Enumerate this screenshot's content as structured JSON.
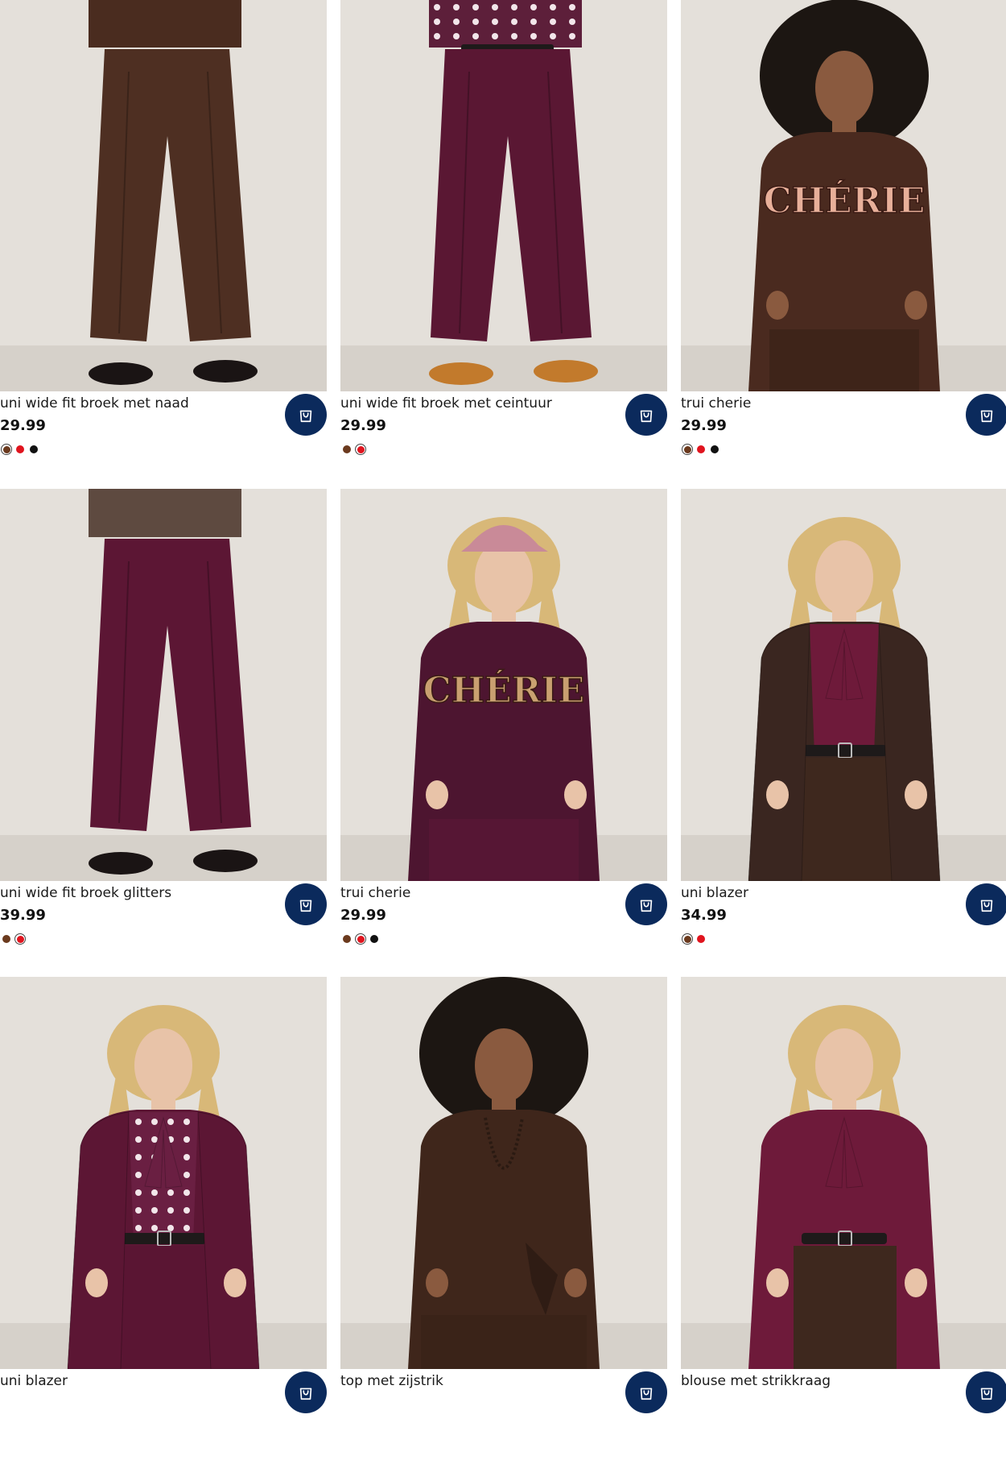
{
  "colors": {
    "cart_button": "#0b2a5c",
    "brown": "#6b3a1e",
    "red": "#e0141e",
    "black": "#111111",
    "photo_background": "#e4e0da"
  },
  "cart_icon": "shopping-bag-icon",
  "products": [
    {
      "name": "uni wide fit broek met naad",
      "price": "29.99",
      "swatches": [
        {
          "color": "#6b3a1e",
          "selected": true
        },
        {
          "color": "#e0141e",
          "selected": false
        },
        {
          "color": "#111111",
          "selected": false
        }
      ],
      "garment_top": "#4a2c1f",
      "garment_bottom": "#4e2f22",
      "hair": "#4a3424",
      "style": "pants"
    },
    {
      "name": "uni wide fit broek met ceintuur",
      "price": "29.99",
      "swatches": [
        {
          "color": "#6b3a1e",
          "selected": false
        },
        {
          "color": "#e0141e",
          "selected": true
        }
      ],
      "garment_top": "#5d1f3a",
      "garment_bottom": "#5a1733",
      "hair": "#4a3424",
      "style": "pants-dots"
    },
    {
      "name": "trui cherie",
      "price": "29.99",
      "swatches": [
        {
          "color": "#6b3a1e",
          "selected": true
        },
        {
          "color": "#e0141e",
          "selected": false
        },
        {
          "color": "#111111",
          "selected": false
        }
      ],
      "garment_top": "#4a2a1f",
      "garment_bottom": "#3e2419",
      "hair": "#1c1612",
      "style": "sweater"
    },
    {
      "name": "uni wide fit broek glitters",
      "price": "39.99",
      "swatches": [
        {
          "color": "#6b3a1e",
          "selected": false
        },
        {
          "color": "#e0141e",
          "selected": true
        }
      ],
      "garment_top": "#5e4a40",
      "garment_bottom": "#5c1634",
      "hair": "#4a3424",
      "style": "pants"
    },
    {
      "name": "trui cherie",
      "price": "29.99",
      "swatches": [
        {
          "color": "#6b3a1e",
          "selected": false
        },
        {
          "color": "#e0141e",
          "selected": true
        },
        {
          "color": "#111111",
          "selected": false
        }
      ],
      "garment_top": "#4d1530",
      "garment_bottom": "#561634",
      "hair": "#d8b878",
      "style": "sweater-cap"
    },
    {
      "name": "uni blazer",
      "price": "34.99",
      "swatches": [
        {
          "color": "#6b3a1e",
          "selected": true
        },
        {
          "color": "#e0141e",
          "selected": false
        }
      ],
      "garment_top": "#3a2620",
      "garment_bottom": "#3e281e",
      "hair": "#d8b878",
      "style": "blazer"
    },
    {
      "name": "uni blazer",
      "price": "",
      "swatches": [],
      "garment_top": "#5c1634",
      "garment_bottom": "#5a1533",
      "hair": "#d8b878",
      "style": "blazer-dots"
    },
    {
      "name": "top met zijstrik",
      "price": "",
      "swatches": [],
      "garment_top": "#3f261b",
      "garment_bottom": "#3a2318",
      "hair": "#1c1612",
      "style": "top"
    },
    {
      "name": "blouse met strikkraag",
      "price": "",
      "swatches": [],
      "garment_top": "#6e1a3a",
      "garment_bottom": "#3e281e",
      "hair": "#d8b878",
      "style": "blouse"
    }
  ]
}
